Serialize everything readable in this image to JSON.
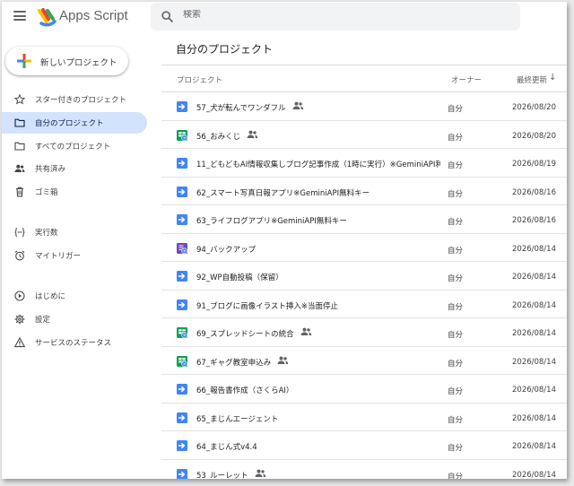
{
  "header": {
    "app_title": "Apps Script",
    "search_placeholder": "検索"
  },
  "sidebar": {
    "new_project_label": "新しいプロジェクト",
    "items": [
      {
        "label": "スター付きのプロジェクト",
        "icon": "star-icon"
      },
      {
        "label": "自分のプロジェクト",
        "icon": "folder-icon",
        "active": true
      },
      {
        "label": "すべてのプロジェクト",
        "icon": "folder-outline-icon"
      },
      {
        "label": "共有済み",
        "icon": "people-icon"
      },
      {
        "label": "ゴミ箱",
        "icon": "trash-icon"
      },
      {
        "label": "実行数",
        "icon": "executions-icon"
      },
      {
        "label": "マイトリガー",
        "icon": "alarm-icon"
      },
      {
        "label": "はじめに",
        "icon": "play-circle-icon"
      },
      {
        "label": "設定",
        "icon": "gear-icon"
      },
      {
        "label": "サービスのステータス",
        "icon": "warning-icon"
      }
    ]
  },
  "main": {
    "title": "自分のプロジェクト",
    "columns": {
      "project": "プロジェクト",
      "owner": "オーナー",
      "modified": "最終更新"
    },
    "rows": [
      {
        "name": "57_犬が転んでワンダフル",
        "type": "standalone",
        "shared": true,
        "owner": "自分",
        "date": "2026/08/20"
      },
      {
        "name": "56_おみくじ",
        "type": "sheets",
        "shared": true,
        "owner": "自分",
        "date": "2026/08/20"
      },
      {
        "name": "11_どもどもAI情報収集しブログ記事作成（1時に実行）※GeminiAPI利...",
        "type": "standalone",
        "shared": false,
        "owner": "自分",
        "date": "2026/08/19"
      },
      {
        "name": "62_スマート写真日報アプリ※GeminiAPI無料キー",
        "type": "standalone",
        "shared": false,
        "owner": "自分",
        "date": "2026/08/16"
      },
      {
        "name": "63_ライフログアプリ※GeminiAPI無料キー",
        "type": "standalone",
        "shared": false,
        "owner": "自分",
        "date": "2026/08/16"
      },
      {
        "name": "94_バックアップ",
        "type": "forms",
        "shared": false,
        "owner": "自分",
        "date": "2026/08/14"
      },
      {
        "name": "92_WP自動投稿（保留）",
        "type": "standalone",
        "shared": false,
        "owner": "自分",
        "date": "2026/08/14"
      },
      {
        "name": "91_ブログに画像イラスト挿入※当面停止",
        "type": "standalone",
        "shared": false,
        "owner": "自分",
        "date": "2026/08/14"
      },
      {
        "name": "69_スプレッドシートの統合",
        "type": "sheets",
        "shared": true,
        "owner": "自分",
        "date": "2026/08/14"
      },
      {
        "name": "67_ギャグ教室申込み",
        "type": "sheets",
        "shared": true,
        "owner": "自分",
        "date": "2026/08/14"
      },
      {
        "name": "66_報告書作成（さくらAI）",
        "type": "standalone",
        "shared": false,
        "owner": "自分",
        "date": "2026/08/14"
      },
      {
        "name": "65_まじんエージェント",
        "type": "standalone",
        "shared": false,
        "owner": "自分",
        "date": "2026/08/14"
      },
      {
        "name": "64_まじん式v4.4",
        "type": "standalone",
        "shared": false,
        "owner": "自分",
        "date": "2026/08/14"
      },
      {
        "name": "53_ルーレット",
        "type": "standalone",
        "shared": true,
        "owner": "自分",
        "date": "2026/08/14"
      }
    ]
  },
  "colors": {
    "accent_active": "#d3e3fd",
    "standalone_icon": "#4285f4",
    "sheets_icon": "#0f9d58",
    "forms_icon": "#7248b9"
  }
}
